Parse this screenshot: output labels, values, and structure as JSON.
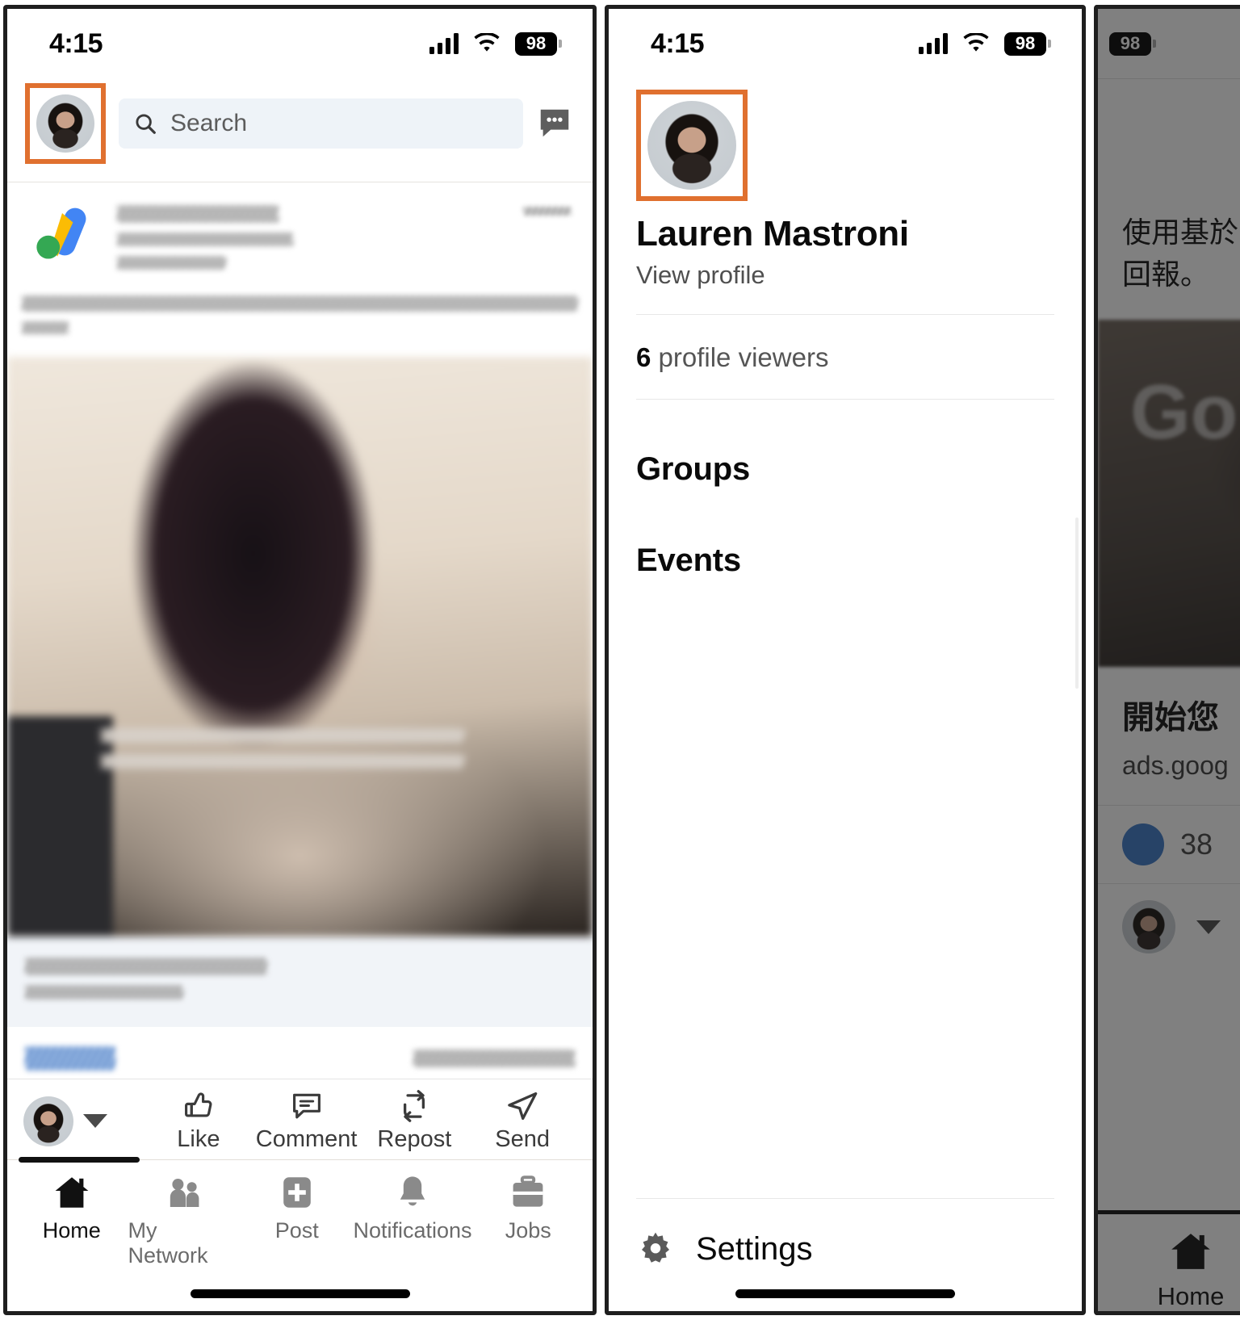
{
  "status_bar": {
    "time": "4:15",
    "battery": "98",
    "signal_icon": "cellular-bars-icon",
    "wifi_icon": "wifi-icon"
  },
  "accent": {
    "highlight_box": "#e0702f",
    "link_blue": "#0a66c2"
  },
  "left_phone": {
    "top_bar": {
      "avatar_name": "avatar-lauren-mastroni",
      "search_placeholder": "Search",
      "search_icon": "search-icon",
      "messaging_icon": "messaging-bubble-icon"
    },
    "post": {
      "author_logo": "google-ads-logo-icon",
      "author_blurred": true,
      "timestamp_blurred": true
    },
    "action_bar": {
      "actions": [
        {
          "label": "Like",
          "icon": "thumbs-up-icon"
        },
        {
          "label": "Comment",
          "icon": "comment-bubble-icon"
        },
        {
          "label": "Repost",
          "icon": "repost-arrows-icon"
        },
        {
          "label": "Send",
          "icon": "send-paper-plane-icon"
        }
      ],
      "caret_icon": "chevron-down-icon"
    },
    "tab_bar": {
      "tabs": [
        {
          "label": "Home",
          "icon": "home-icon",
          "active": true
        },
        {
          "label": "My Network",
          "icon": "people-icon",
          "active": false
        },
        {
          "label": "Post",
          "icon": "plus-square-icon",
          "active": false
        },
        {
          "label": "Notifications",
          "icon": "bell-icon",
          "active": false
        },
        {
          "label": "Jobs",
          "icon": "briefcase-icon",
          "active": false
        }
      ]
    }
  },
  "middle_phone": {
    "profile": {
      "avatar_name": "avatar-lauren-mastroni",
      "name": "Lauren Mastroni",
      "view_profile": "View profile"
    },
    "viewers": {
      "count": "6",
      "label": "profile viewers"
    },
    "menu_items": [
      {
        "label": "Groups"
      },
      {
        "label": "Events"
      }
    ],
    "settings": {
      "label": "Settings",
      "icon": "gear-icon"
    }
  },
  "right_phone_dimmed": {
    "sponsored_card": {
      "logo": "google-ads-logo-icon",
      "text_line_1": "使用基於",
      "text_line_2": "回報。"
    },
    "hero_watermark": "Go",
    "link_title": "開始您",
    "link_url": "ads.goog",
    "reactions": {
      "count": "38",
      "icon": "thumbs-up-filled-icon"
    },
    "tab_bar": {
      "tabs": [
        {
          "label": "Home",
          "icon": "home-icon",
          "active": true
        }
      ]
    },
    "caret_icon": "chevron-down-icon"
  }
}
